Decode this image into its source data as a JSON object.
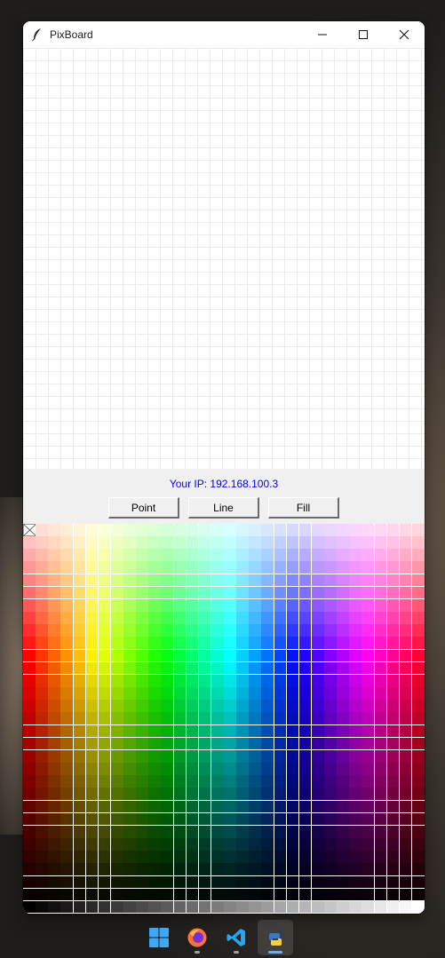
{
  "window": {
    "title": "PixBoard",
    "minimize_icon": "minimize-icon",
    "maximize_icon": "maximize-icon",
    "close_icon": "close-icon",
    "app_icon": "feather-icon"
  },
  "canvas": {
    "grid_color": "#ececec",
    "background": "#ffffff"
  },
  "status": {
    "ip_text": "Your IP: 192.168.100.3",
    "ip_color": "#0000ee"
  },
  "tools": {
    "point_label": "Point",
    "line_label": "Line",
    "fill_label": "Fill"
  },
  "palette": {
    "columns": 32,
    "rows": 31,
    "first_swatch": "transparent-swatch",
    "hue_start_color": "#ff0000",
    "grayscale_row": true
  },
  "taskbar": {
    "items": [
      {
        "name": "windows-start-icon",
        "active": false
      },
      {
        "name": "firefox-icon",
        "active": false
      },
      {
        "name": "vscode-icon",
        "active": false
      },
      {
        "name": "python-icon",
        "active": true
      }
    ]
  }
}
